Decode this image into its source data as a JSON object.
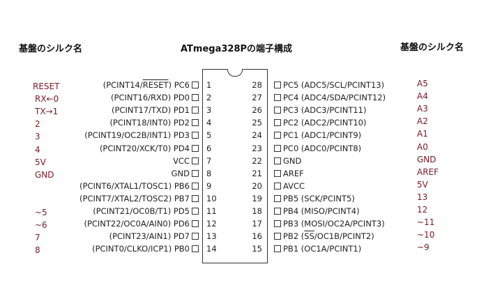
{
  "header": {
    "left_label": "基盤のシルク名",
    "title": "ATmega328Pの端子構成",
    "right_label": "基盤のシルク名"
  },
  "left_pins": [
    {
      "pre": "(PCINT14/",
      "overline": "RESET",
      "post": ") PC6",
      "num": "1",
      "silk": "RESET"
    },
    {
      "pre": "(PCINT16/RXD) PD0",
      "overline": "",
      "post": "",
      "num": "2",
      "silk": "RX←0"
    },
    {
      "pre": "(PCINT17/TXD) PD1",
      "overline": "",
      "post": "",
      "num": "3",
      "silk": "TX→1"
    },
    {
      "pre": "(PCINT18/INT0) PD2",
      "overline": "",
      "post": "",
      "num": "4",
      "silk": "2"
    },
    {
      "pre": "(PCINT19/OC2B/INT1) PD3",
      "overline": "",
      "post": "",
      "num": "5",
      "silk": "3"
    },
    {
      "pre": "(PCINT20/XCK/T0) PD4",
      "overline": "",
      "post": "",
      "num": "6",
      "silk": "4"
    },
    {
      "pre": "VCC",
      "overline": "",
      "post": "",
      "num": "7",
      "silk": "5V"
    },
    {
      "pre": "GND",
      "overline": "",
      "post": "",
      "num": "8",
      "silk": "GND"
    },
    {
      "pre": "(PCINT6/XTAL1/TOSC1) PB6",
      "overline": "",
      "post": "",
      "num": "9",
      "silk": ""
    },
    {
      "pre": "(PCINT7/XTAL2/TOSC2) PB7",
      "overline": "",
      "post": "",
      "num": "10",
      "silk": ""
    },
    {
      "pre": "(PCINT21/OC0B/T1) PD5",
      "overline": "",
      "post": "",
      "num": "11",
      "silk": "~5"
    },
    {
      "pre": "(PCINT22/OC0A/AIN0) PD6",
      "overline": "",
      "post": "",
      "num": "12",
      "silk": "~6"
    },
    {
      "pre": "(PCINT23/AIN1) PD7",
      "overline": "",
      "post": "",
      "num": "13",
      "silk": "7"
    },
    {
      "pre": "(PCINT0/CLKO/ICP1) PB0",
      "overline": "",
      "post": "",
      "num": "14",
      "silk": "8"
    }
  ],
  "right_pins": [
    {
      "num": "28",
      "pre": "PC5 (ADC5/SCL/PCINT13)",
      "overline": "",
      "post": "",
      "silk": "A5"
    },
    {
      "num": "27",
      "pre": "PC4 (ADC4/SDA/PCINT12)",
      "overline": "",
      "post": "",
      "silk": "A4"
    },
    {
      "num": "26",
      "pre": "PC3 (ADC3/PCINT11)",
      "overline": "",
      "post": "",
      "silk": "A3"
    },
    {
      "num": "25",
      "pre": "PC2 (ADC2/PCINT10)",
      "overline": "",
      "post": "",
      "silk": "A2"
    },
    {
      "num": "24",
      "pre": "PC1 (ADC1/PCINT9)",
      "overline": "",
      "post": "",
      "silk": "A1"
    },
    {
      "num": "23",
      "pre": "PC0 (ADC0/PCINT8)",
      "overline": "",
      "post": "",
      "silk": "A0"
    },
    {
      "num": "22",
      "pre": "GND",
      "overline": "",
      "post": "",
      "silk": "GND"
    },
    {
      "num": "21",
      "pre": "AREF",
      "overline": "",
      "post": "",
      "silk": "AREF"
    },
    {
      "num": "20",
      "pre": "AVCC",
      "overline": "",
      "post": "",
      "silk": "5V"
    },
    {
      "num": "19",
      "pre": "PB5 (SCK/PCINT5)",
      "overline": "",
      "post": "",
      "silk": "13"
    },
    {
      "num": "18",
      "pre": "PB4 (MISO/PCINT4)",
      "overline": "",
      "post": "",
      "silk": "12"
    },
    {
      "num": "17",
      "pre": "PB3 (MOSI/OC2A/PCINT3)",
      "overline": "",
      "post": "",
      "silk": "~11"
    },
    {
      "num": "16",
      "pre": "PB2 (",
      "overline": "SS",
      "post": "/OC1B/PCINT2)",
      "silk": "~10"
    },
    {
      "num": "15",
      "pre": "PB1 (OC1A/PCINT1)",
      "overline": "",
      "post": "",
      "silk": "~9"
    }
  ]
}
